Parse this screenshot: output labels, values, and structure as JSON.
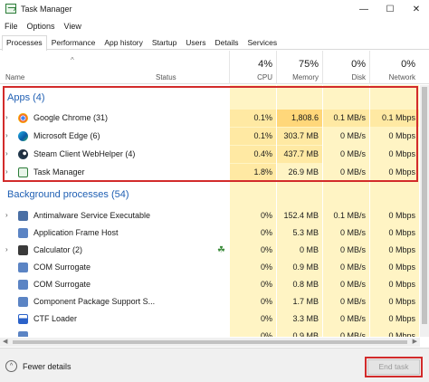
{
  "window": {
    "title": "Task Manager",
    "minimize_glyph": "—",
    "maximize_glyph": "☐",
    "close_glyph": "✕"
  },
  "menu": [
    "File",
    "Options",
    "View"
  ],
  "tabs": [
    "Processes",
    "Performance",
    "App history",
    "Startup",
    "Users",
    "Details",
    "Services"
  ],
  "active_tab": "Processes",
  "columns": {
    "name": "Name",
    "status": "Status",
    "cpu": {
      "label": "CPU",
      "total": "4%"
    },
    "memory": {
      "label": "Memory",
      "total": "75%"
    },
    "disk": {
      "label": "Disk",
      "total": "0%"
    },
    "network": {
      "label": "Network",
      "total": "0%"
    }
  },
  "apps_group": {
    "title": "Apps (4)",
    "rows": [
      {
        "name": "Google Chrome (31)",
        "icon": "chrome-icon",
        "cpu": "0.1%",
        "memory": "1,808.6 MB",
        "disk": "0.1 MB/s",
        "network": "0.1 Mbps"
      },
      {
        "name": "Microsoft Edge (6)",
        "icon": "edge-icon",
        "cpu": "0.1%",
        "memory": "303.7 MB",
        "disk": "0 MB/s",
        "network": "0 Mbps"
      },
      {
        "name": "Steam Client WebHelper (4)",
        "icon": "steam-icon",
        "cpu": "0.4%",
        "memory": "437.7 MB",
        "disk": "0 MB/s",
        "network": "0 Mbps"
      },
      {
        "name": "Task Manager",
        "icon": "task-manager-icon",
        "cpu": "1.8%",
        "memory": "26.9 MB",
        "disk": "0 MB/s",
        "network": "0 Mbps"
      }
    ]
  },
  "background_group": {
    "title": "Background processes (54)",
    "rows": [
      {
        "name": "Antimalware Service Executable",
        "icon": "shield-app-icon",
        "expandable": true,
        "cpu": "0%",
        "memory": "152.4 MB",
        "disk": "0.1 MB/s",
        "network": "0 Mbps"
      },
      {
        "name": "Application Frame Host",
        "icon": "window-app-icon",
        "expandable": false,
        "cpu": "0%",
        "memory": "5.3 MB",
        "disk": "0 MB/s",
        "network": "0 Mbps"
      },
      {
        "name": "Calculator (2)",
        "icon": "calculator-icon",
        "expandable": true,
        "suspended": true,
        "cpu": "0%",
        "memory": "0 MB",
        "disk": "0 MB/s",
        "network": "0 Mbps"
      },
      {
        "name": "COM Surrogate",
        "icon": "window-app-icon",
        "expandable": false,
        "cpu": "0%",
        "memory": "0.9 MB",
        "disk": "0 MB/s",
        "network": "0 Mbps"
      },
      {
        "name": "COM Surrogate",
        "icon": "window-app-icon",
        "expandable": false,
        "cpu": "0%",
        "memory": "0.8 MB",
        "disk": "0 MB/s",
        "network": "0 Mbps"
      },
      {
        "name": "Component Package Support S...",
        "icon": "window-app-icon",
        "expandable": false,
        "cpu": "0%",
        "memory": "1.7 MB",
        "disk": "0 MB/s",
        "network": "0 Mbps"
      },
      {
        "name": "CTF Loader",
        "icon": "ctf-loader-icon",
        "expandable": false,
        "cpu": "0%",
        "memory": "3.3 MB",
        "disk": "0 MB/s",
        "network": "0 Mbps"
      },
      {
        "name": "",
        "icon": "window-app-icon",
        "expandable": false,
        "cpu": "0%",
        "memory": "0.9 MB",
        "disk": "0 MB/s",
        "network": "0 Mbps"
      }
    ]
  },
  "footer": {
    "fewer_details": "Fewer details",
    "end_task": "End task"
  },
  "colors": {
    "accent_group_title": "#1f5fb3",
    "column_highlight": "#fff4c4",
    "column_highlight_strong": "#ffe9a3",
    "annotation_red": "#d22b2b"
  }
}
